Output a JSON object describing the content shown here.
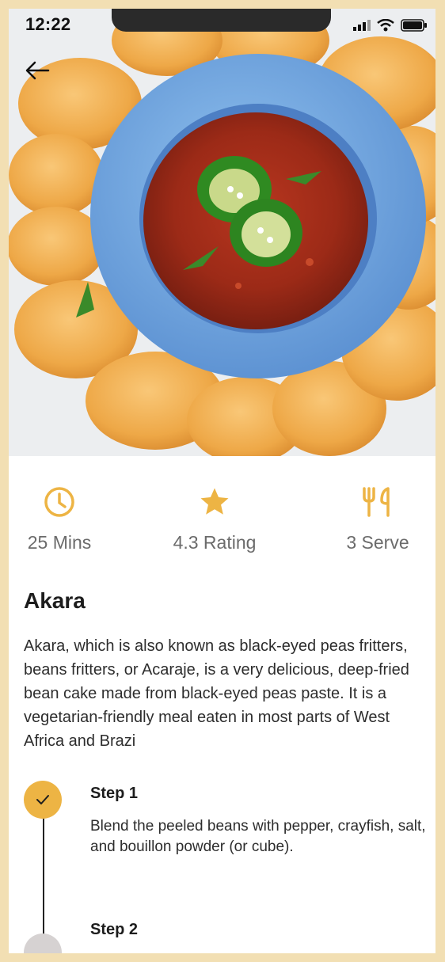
{
  "status_bar": {
    "time": "12:22"
  },
  "hero": {
    "image": "akara-with-pepper-sauce-photo"
  },
  "stats": [
    {
      "icon": "clock-icon",
      "label": "25 Mins"
    },
    {
      "icon": "star-icon",
      "label": "4.3 Rating"
    },
    {
      "icon": "cutlery-icon",
      "label": "3 Serve"
    }
  ],
  "recipe": {
    "title": "Akara",
    "description": "Akara, which is also known as black-eyed peas fritters, beans fritters, or Acaraje, is a very delicious, deep-fried bean cake made from black-eyed peas paste. It is a vegetarian-friendly meal eaten in most parts of West Africa and Brazi"
  },
  "steps": [
    {
      "title": "Step 1",
      "text": "Blend the peeled beans with pepper, crayfish, salt, and bouillon powder (or cube).",
      "done": true
    },
    {
      "title": "Step 2",
      "text": "",
      "done": false
    }
  ],
  "colors": {
    "accent": "#edb444",
    "frame": "#f2dfb3",
    "muted_text": "#6b6b6b"
  }
}
